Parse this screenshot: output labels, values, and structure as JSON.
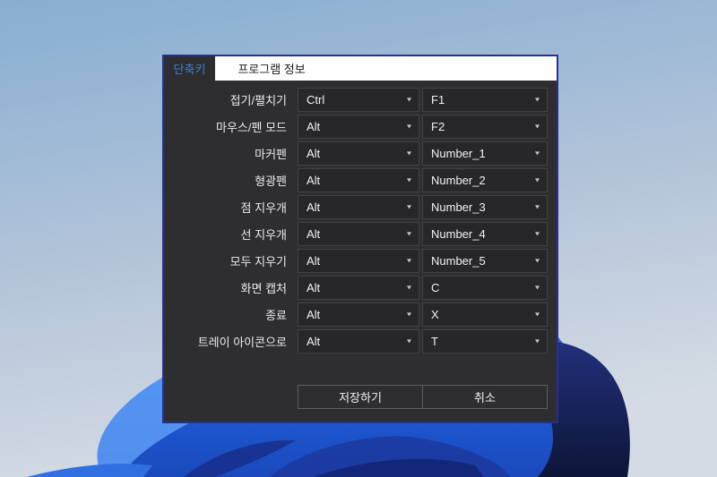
{
  "window": {
    "tabs": [
      {
        "label": "단축키",
        "active": true
      },
      {
        "label": "프로그램 정보",
        "active": false
      }
    ],
    "shortcut_rows": [
      {
        "label": "접기/펼치기",
        "modifier": "Ctrl",
        "key": "F1"
      },
      {
        "label": "마우스/펜 모드",
        "modifier": "Alt",
        "key": "F2"
      },
      {
        "label": "마커펜",
        "modifier": "Alt",
        "key": "Number_1"
      },
      {
        "label": "형광펜",
        "modifier": "Alt",
        "key": "Number_2"
      },
      {
        "label": "점 지우개",
        "modifier": "Alt",
        "key": "Number_3"
      },
      {
        "label": "선 지우개",
        "modifier": "Alt",
        "key": "Number_4"
      },
      {
        "label": "모두 지우기",
        "modifier": "Alt",
        "key": "Number_5"
      },
      {
        "label": "화면 캡처",
        "modifier": "Alt",
        "key": "C"
      },
      {
        "label": "종료",
        "modifier": "Alt",
        "key": "X"
      },
      {
        "label": "트레이 아이콘으로",
        "modifier": "Alt",
        "key": "T"
      }
    ],
    "save_label": "저장하기",
    "cancel_label": "취소"
  },
  "icons": {
    "chevron_down": "▾"
  },
  "colors": {
    "dialog_bg": "#2e2e30",
    "dialog_border": "#27308e",
    "active_tab_text": "#3e82c4",
    "combo_bg": "#27272a",
    "combo_border": "#434346",
    "wallpaper_top": "#88aed1",
    "wallpaper_bottom": "#d4dbe4",
    "bloom_blue": "#2266e4",
    "bloom_navy": "#0d1538"
  }
}
